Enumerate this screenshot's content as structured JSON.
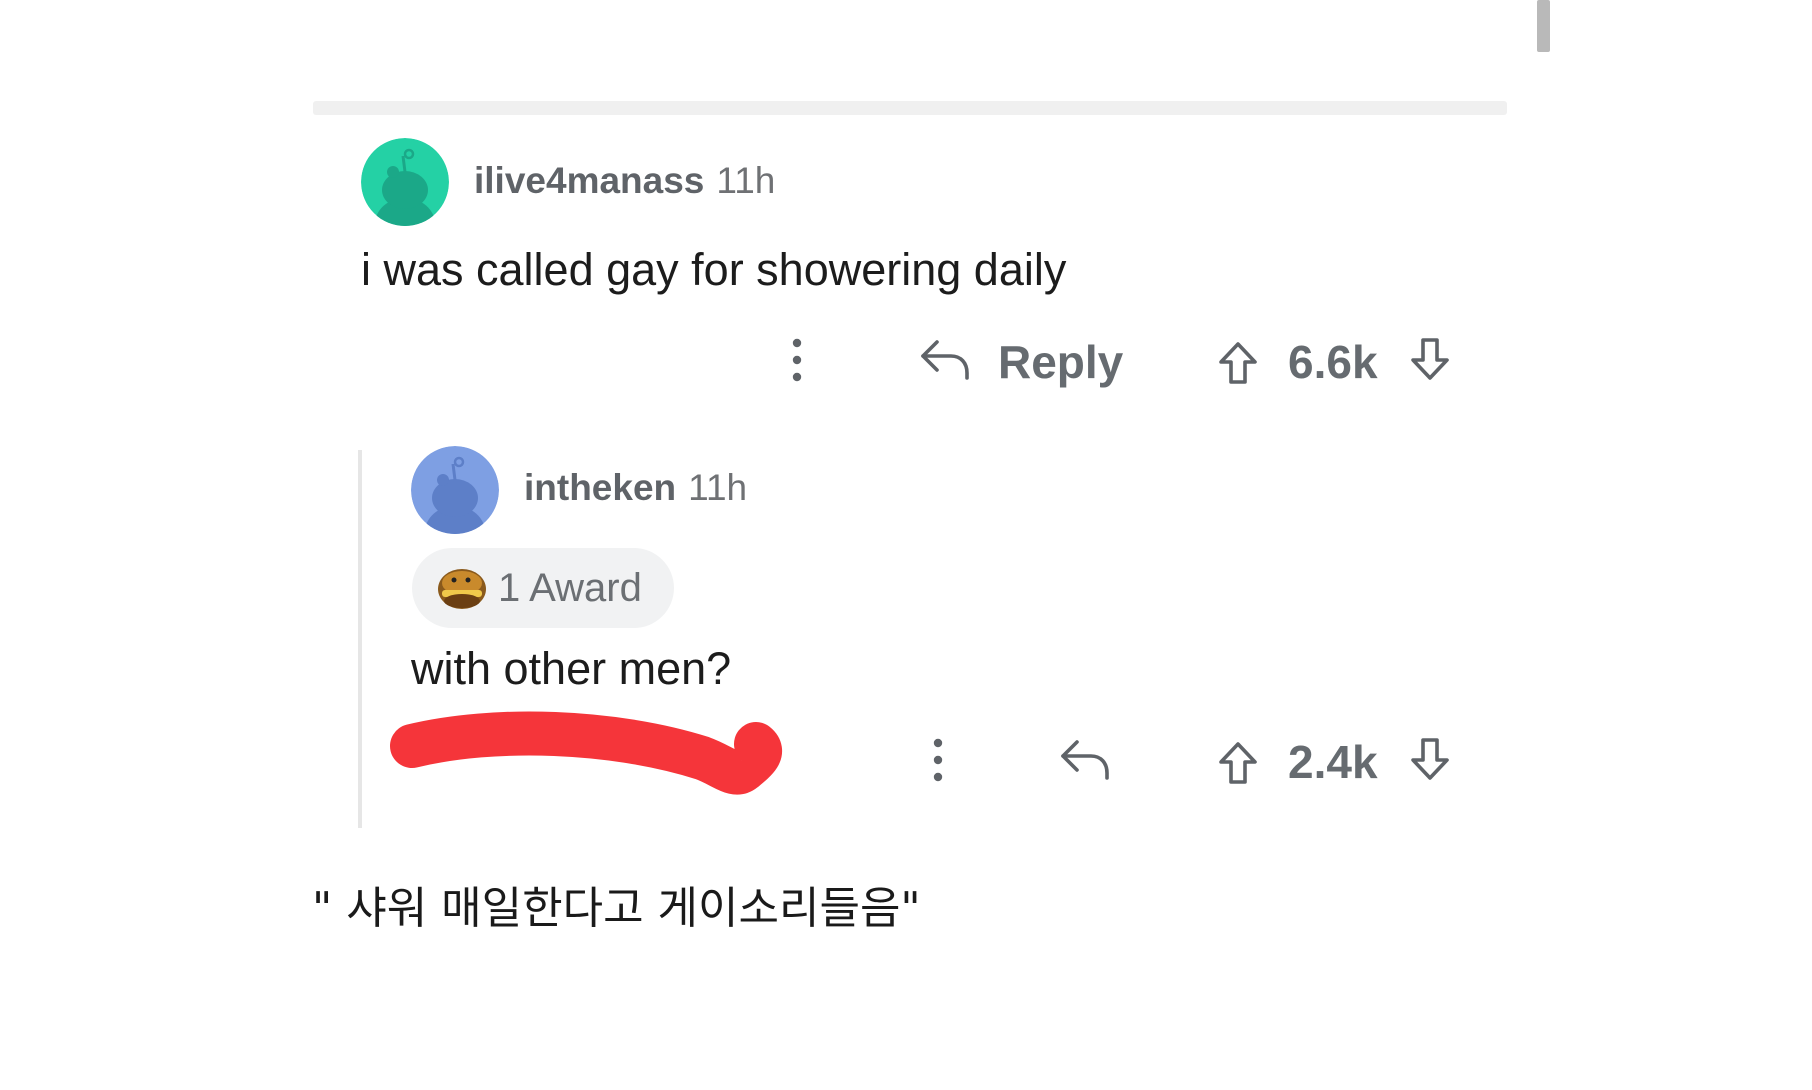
{
  "comments": [
    {
      "username": "ilive4manass",
      "time": "11h",
      "body": "i was called gay for showering daily",
      "reply_label": "Reply",
      "votes": "6.6k",
      "avatar_color": "#24d1a5"
    },
    {
      "username": "intheken",
      "time": "11h",
      "award_label": "1 Award",
      "body": "with other men?",
      "votes": "2.4k",
      "avatar_color": "#7e9fe3"
    }
  ],
  "caption": "\" 샤워 매일한다고 게이소리들음\"",
  "colors": {
    "redaction": "#f5353a",
    "meta_text": "#5f6368",
    "action_text": "#666b70",
    "divider": "#f0f0f0"
  },
  "icons": [
    "snoo-avatar-icon",
    "more-options-icon",
    "reply-arrow-icon",
    "upvote-arrow-icon",
    "downvote-arrow-icon",
    "award-icon"
  ]
}
